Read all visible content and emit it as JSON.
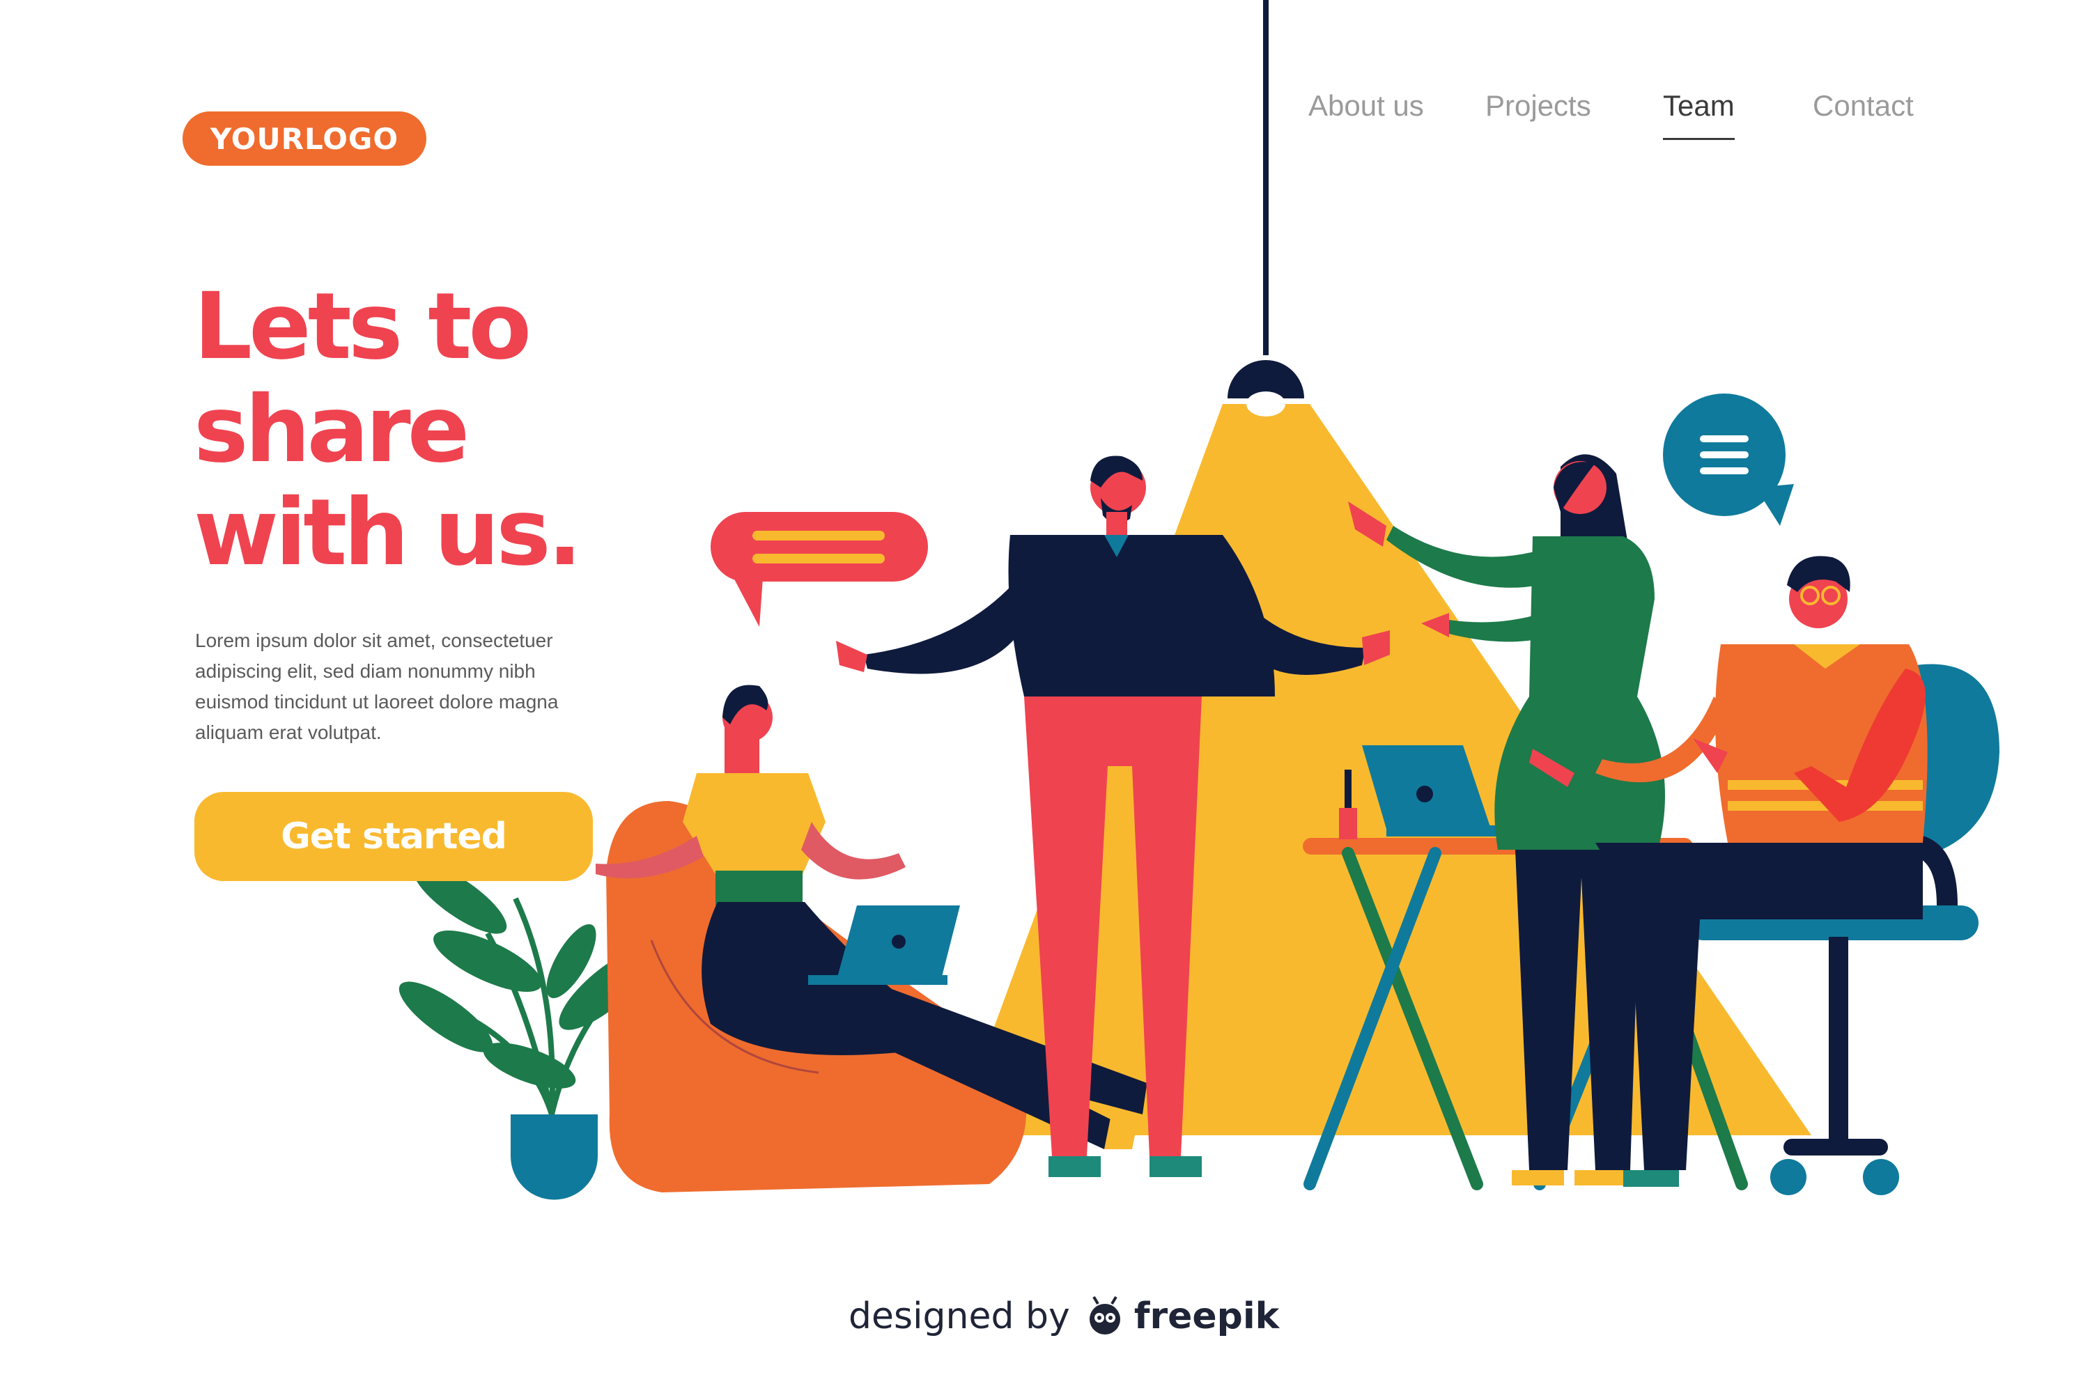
{
  "logo": {
    "text": "YOURLOGO"
  },
  "nav": {
    "items": [
      {
        "label": "About us"
      },
      {
        "label": "Projects"
      },
      {
        "label": "Team",
        "active": true
      },
      {
        "label": "Contact"
      }
    ]
  },
  "hero": {
    "headline_line1": "Lets to",
    "headline_line2": "share",
    "headline_line3": "with us.",
    "body_line1": "Lorem ipsum dolor sit amet, consectetuer",
    "body_line2": "adipiscing elit, sed diam nonummy nibh",
    "body_line3": "euismod tincidunt ut laoreet dolore magna",
    "body_line4": "aliquam erat volutpat.",
    "cta_label": "Get started"
  },
  "footer": {
    "credit_prefix": "designed by",
    "credit_brand": "freepik"
  },
  "colors": {
    "accent_red": "#ef4350",
    "logo_orange": "#ef6c2e",
    "cta_yellow": "#f9b92f",
    "navy": "#0f1b3d",
    "teal_blue": "#0f7a9c",
    "green": "#1d7a4a"
  },
  "icons": [
    "chat-bubble-icon",
    "menu-lines-icon",
    "laptop-icon",
    "freepik-bug-icon"
  ]
}
